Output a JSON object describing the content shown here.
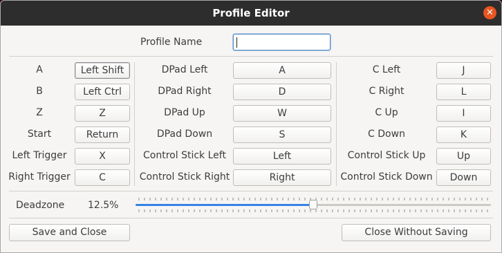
{
  "window": {
    "title": "Profile Editor"
  },
  "profile": {
    "label": "Profile Name",
    "value": ""
  },
  "columns": [
    {
      "rows": [
        {
          "label": "A",
          "key": "Left Shift"
        },
        {
          "label": "B",
          "key": "Left Ctrl"
        },
        {
          "label": "Z",
          "key": "Z"
        },
        {
          "label": "Start",
          "key": "Return"
        },
        {
          "label": "Left Trigger",
          "key": "X"
        },
        {
          "label": "Right Trigger",
          "key": "C"
        }
      ]
    },
    {
      "rows": [
        {
          "label": "DPad Left",
          "key": "A"
        },
        {
          "label": "DPad Right",
          "key": "D"
        },
        {
          "label": "DPad Up",
          "key": "W"
        },
        {
          "label": "DPad Down",
          "key": "S"
        },
        {
          "label": "Control Stick Left",
          "key": "Left"
        },
        {
          "label": "Control Stick Right",
          "key": "Right"
        }
      ]
    },
    {
      "rows": [
        {
          "label": "C Left",
          "key": "J"
        },
        {
          "label": "C Right",
          "key": "L"
        },
        {
          "label": "C Up",
          "key": "I"
        },
        {
          "label": "C Down",
          "key": "K"
        },
        {
          "label": "Control Stick Up",
          "key": "Up"
        },
        {
          "label": "Control Stick Down",
          "key": "Down"
        }
      ]
    }
  ],
  "deadzone": {
    "label": "Deadzone",
    "value_text": "12.5%",
    "slider_fraction": 0.5
  },
  "actions": {
    "save": "Save and Close",
    "discard": "Close Without Saving"
  },
  "colors": {
    "accent": "#3584e4",
    "close": "#e95420",
    "titlebar": "#2d2d2d"
  }
}
